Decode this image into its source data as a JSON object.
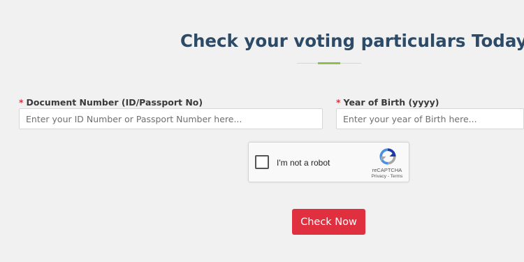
{
  "page": {
    "title": "Check your voting particulars Today!"
  },
  "form": {
    "required_mark": "*",
    "document": {
      "label": "Document Number (ID/Passport No)",
      "placeholder": "Enter your ID Number or Passport Number here...",
      "value": ""
    },
    "year": {
      "label": "Year of Birth (yyyy)",
      "placeholder": "Enter your year of Birth here...",
      "value": ""
    },
    "submit_label": "Check Now"
  },
  "captcha": {
    "label": "I'm not a robot",
    "brand": "reCAPTCHA",
    "privacy": "Privacy",
    "separator": " - ",
    "terms": "Terms",
    "checked": false,
    "logo_icon": "recaptcha-logo-icon"
  },
  "colors": {
    "title": "#2d4a66",
    "accent_underline": "#8cc152",
    "required": "#e0303f",
    "button": "#e0303f",
    "background": "#f1f1f1"
  }
}
